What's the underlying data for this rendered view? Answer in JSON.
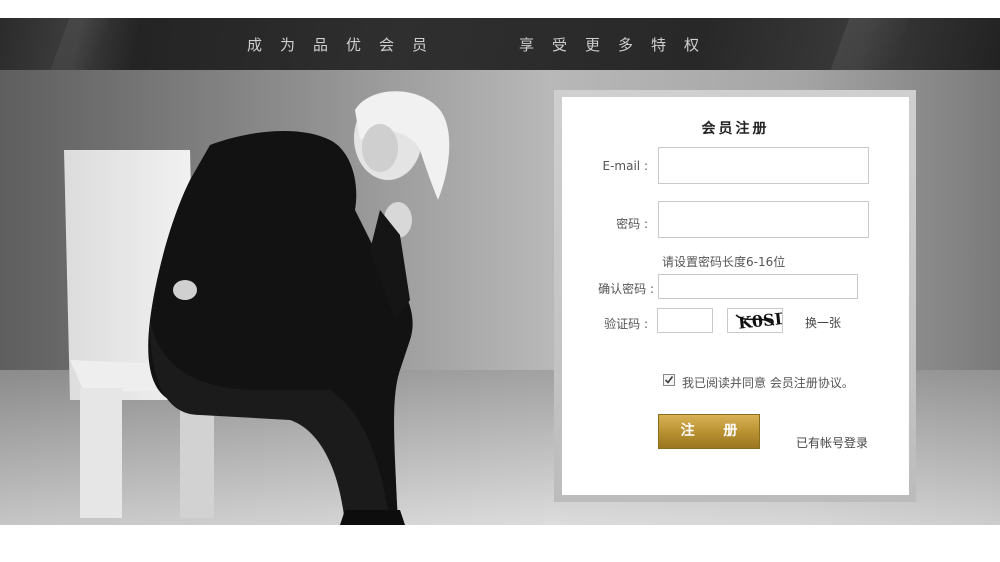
{
  "banner": {
    "slogan_left": "成为品优会员",
    "slogan_right": "享受更多特权"
  },
  "form": {
    "title": "会员注册",
    "email_label": "E-mail :",
    "email_value": "",
    "password_label": "密码 :",
    "password_value": "",
    "password_hint": "请设置密码长度6-16位",
    "confirm_label": "确认密码 :",
    "confirm_value": "",
    "captcha_label": "验证码 :",
    "captcha_value": "",
    "captcha_text": "K0SD",
    "refresh_label": "换一张",
    "agree_checked": true,
    "agree_text": "我已阅读并同意 会员注册协议。",
    "submit_label": "注 册",
    "login_link": "已有帐号登录"
  },
  "colors": {
    "button_gold": "#b99232",
    "banner_dark": "#2f2f2f"
  },
  "icons": {
    "checkbox": "check-icon"
  }
}
